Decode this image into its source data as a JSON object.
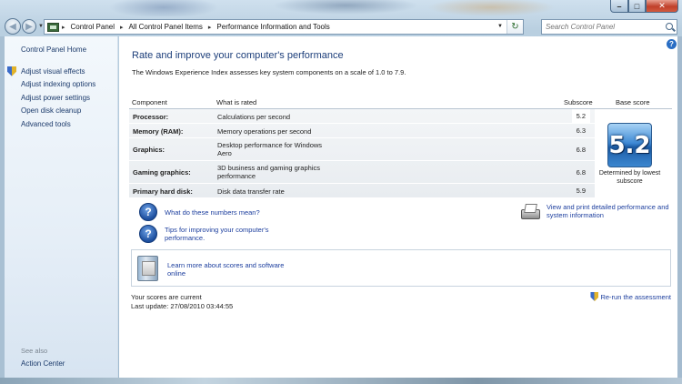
{
  "window": {
    "caption_minimize": "–",
    "caption_maximize": "□",
    "caption_close": "✕"
  },
  "address_bar": {
    "crumbs": [
      "Control Panel",
      "All Control Panel Items",
      "Performance Information and Tools"
    ],
    "separator": "▸",
    "refresh_glyph": "↻"
  },
  "search": {
    "placeholder": "Search Control Panel"
  },
  "sidebar": {
    "home": "Control Panel Home",
    "links": [
      {
        "label": "Adjust visual effects",
        "icon": "shield-icon"
      },
      {
        "label": "Adjust indexing options",
        "icon": ""
      },
      {
        "label": "Adjust power settings",
        "icon": ""
      },
      {
        "label": "Open disk cleanup",
        "icon": ""
      },
      {
        "label": "Advanced tools",
        "icon": ""
      }
    ],
    "see_also": "See also",
    "action_center": "Action Center"
  },
  "main": {
    "title": "Rate and improve your computer's performance",
    "intro": "The Windows Experience Index assesses key system components on a scale of 1.0 to 7.9.",
    "headers": {
      "component": "Component",
      "what_is_rated": "What is rated",
      "subscore": "Subscore",
      "base_score": "Base score"
    },
    "rows": [
      {
        "component": "Processor:",
        "rated": "Calculations per second",
        "subscore": "5.2"
      },
      {
        "component": "Memory (RAM):",
        "rated": "Memory operations per second",
        "subscore": "6.3"
      },
      {
        "component": "Graphics:",
        "rated": "Desktop performance for Windows Aero",
        "subscore": "6.8"
      },
      {
        "component": "Gaming graphics:",
        "rated": "3D business and gaming graphics performance",
        "subscore": "6.8"
      },
      {
        "component": "Primary hard disk:",
        "rated": "Disk data transfer rate",
        "subscore": "5.9"
      }
    ],
    "base_score": "5.2",
    "base_caption": "Determined by lowest subscore",
    "help_links": {
      "numbers": "What do these numbers mean?",
      "tips": "Tips for improving your computer's performance.",
      "print": "View and print detailed performance and system information"
    },
    "learn_more": "Learn more about scores and software online",
    "status": "Your scores are current",
    "last_update": "Last update: 27/08/2010 03:44:55",
    "rerun": "Re-run the assessment"
  },
  "colors": {
    "link": "#1c3e9e",
    "title": "#1c3e7a",
    "badge": "#3f8ad5"
  }
}
